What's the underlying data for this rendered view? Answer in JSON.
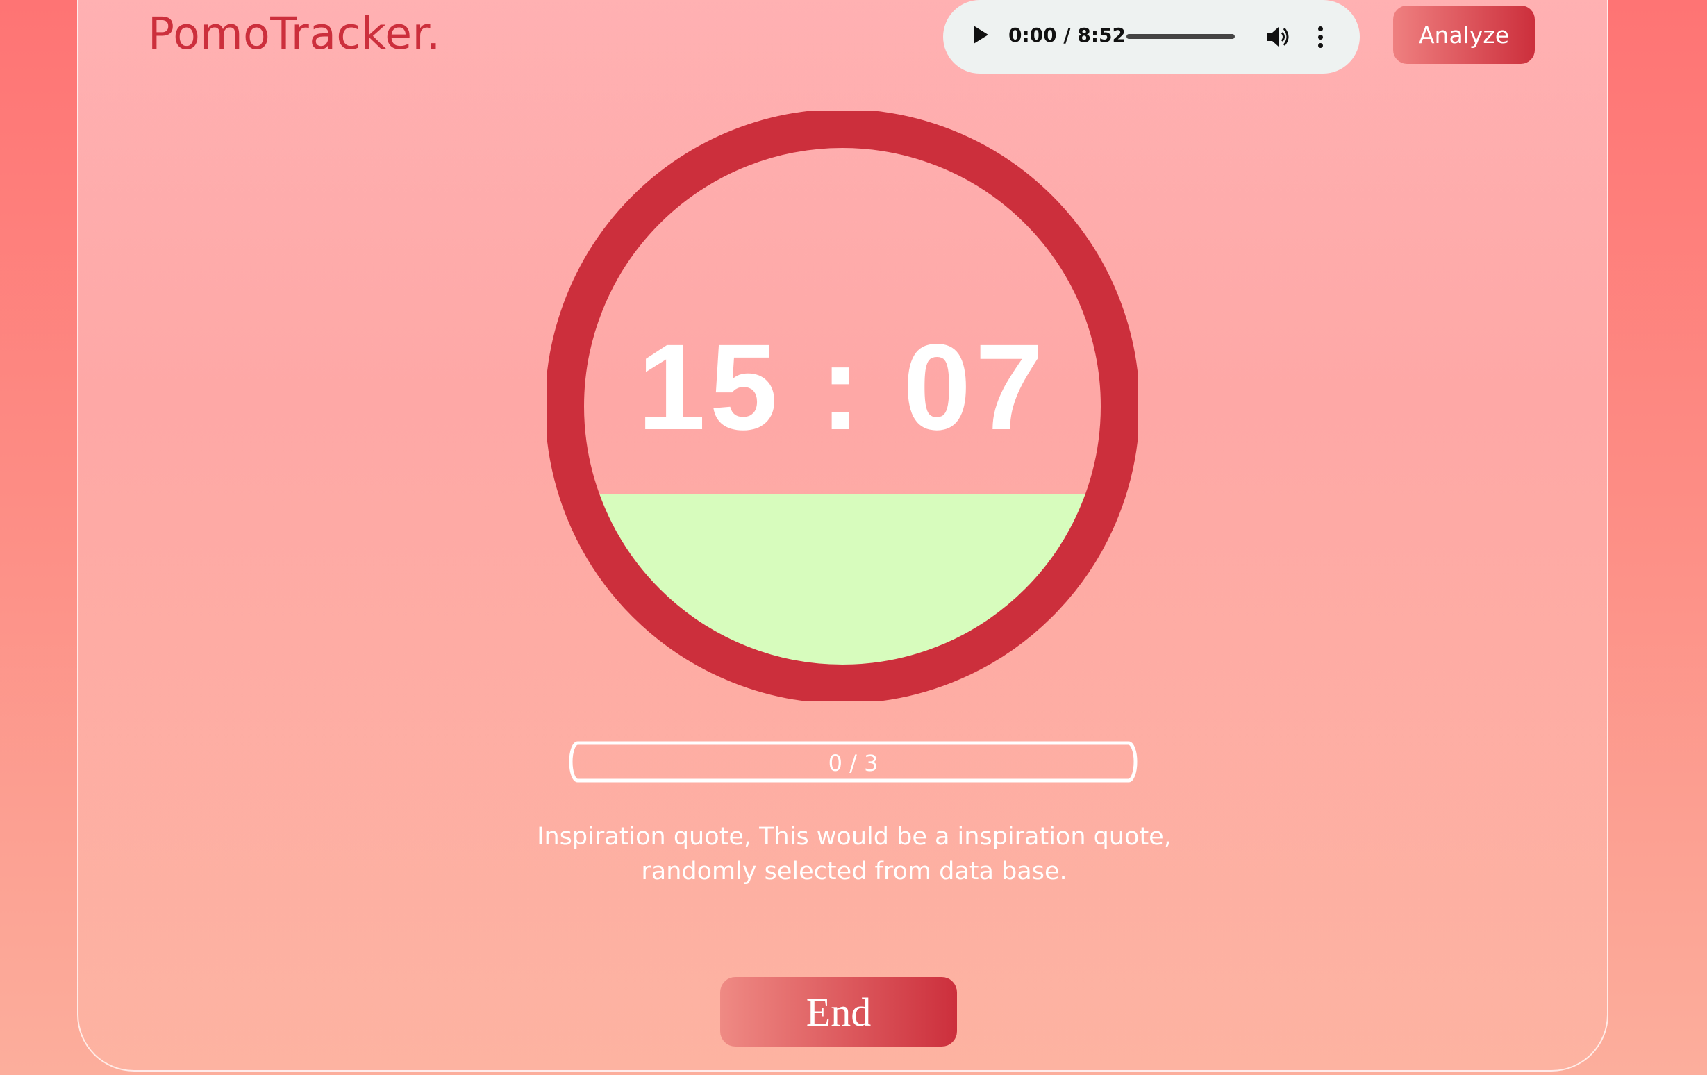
{
  "app": {
    "logo_text": "PomoTracker."
  },
  "audio_player": {
    "time_display": "0:00 / 8:52",
    "play_icon": "play-icon",
    "volume_icon": "volume-icon",
    "more_icon": "more-vertical-icon",
    "progress": 0
  },
  "header": {
    "analyze_label": "Analyze"
  },
  "timer": {
    "display": "15 : 07",
    "fill_fraction": 0.33,
    "ring_color": "#cc2f3c",
    "fill_color": "#d7fcbd"
  },
  "sessions": {
    "label": "0 / 3",
    "completed": 0,
    "total": 3
  },
  "quote": {
    "line1": "Inspiration quote, This would be a inspiration quote,",
    "line2": "randomly selected from data base."
  },
  "actions": {
    "end_label": "End"
  },
  "colors": {
    "accent": "#cc2f3c",
    "background_top": "#fe7474",
    "background_bottom": "#fcae9c"
  }
}
